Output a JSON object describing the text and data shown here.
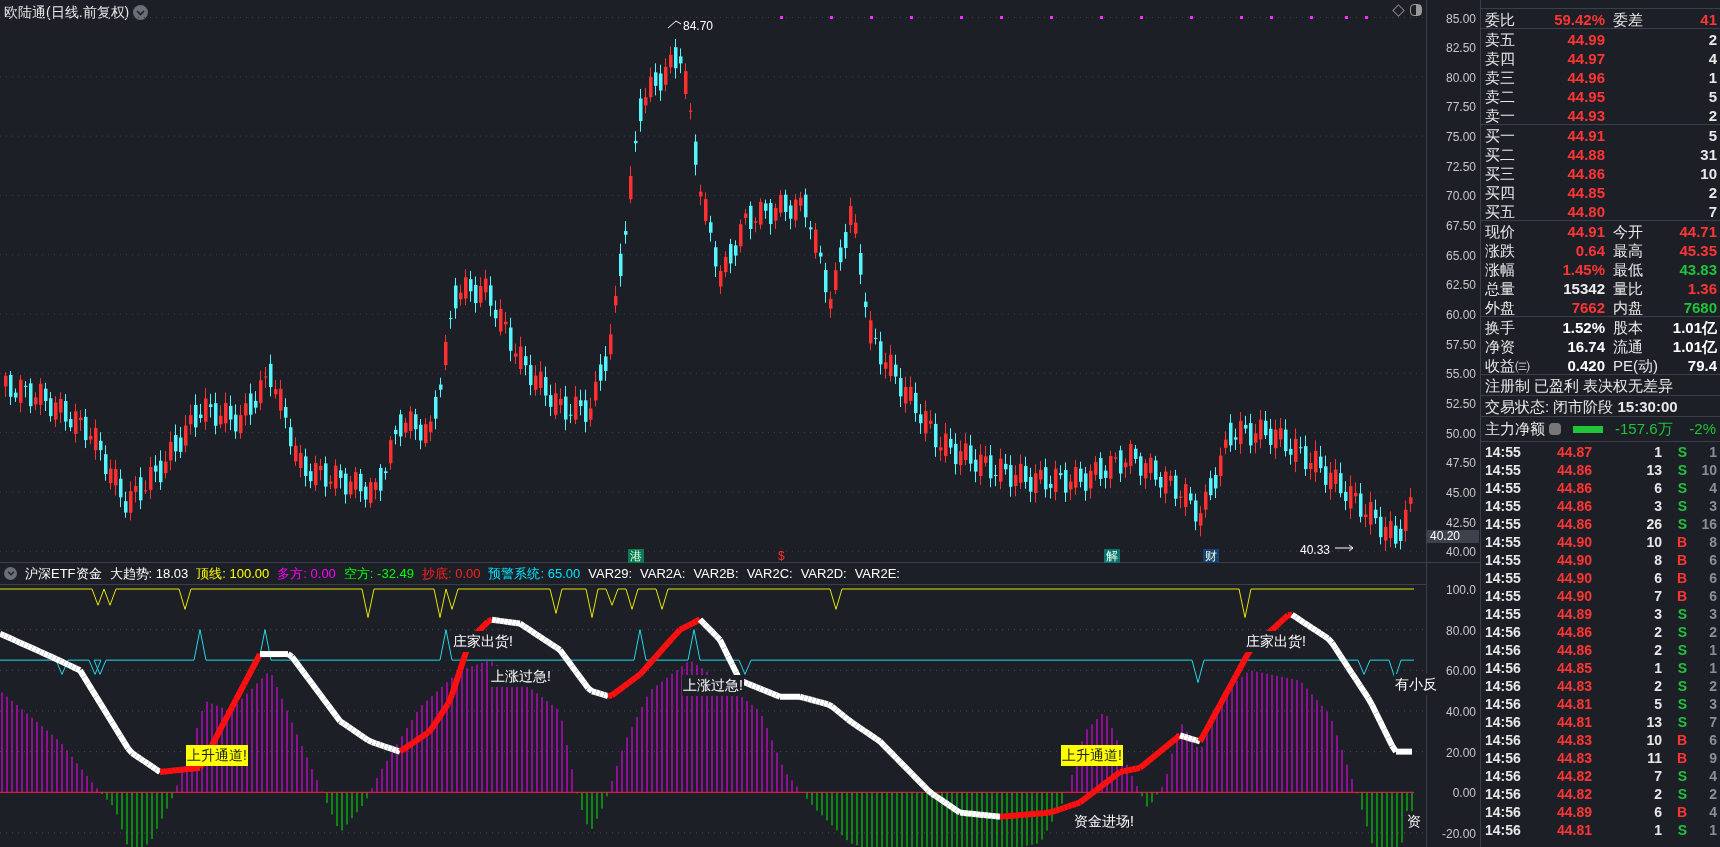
{
  "chart": {
    "title": "欧陆通(日线.前复权)",
    "high_label": "84.70",
    "low_label": "40.33",
    "current_price": "40.20",
    "price_ticks": [
      "85.00",
      "82.50",
      "80.00",
      "77.50",
      "75.00",
      "72.50",
      "70.00",
      "67.50",
      "65.00",
      "62.50",
      "60.00",
      "57.50",
      "55.00",
      "52.50",
      "50.00",
      "47.50",
      "45.00",
      "42.50",
      "40.00"
    ],
    "event_marks": [
      {
        "text": "港",
        "kind": "badge",
        "color": "#0b7a52"
      },
      {
        "text": "$",
        "kind": "plain",
        "color": "#ff2d2d"
      },
      {
        "text": "解",
        "kind": "badge",
        "color": "#0f7070"
      },
      {
        "text": "财",
        "kind": "badge",
        "color": "#1d3f6b"
      }
    ]
  },
  "indicator": {
    "legend": [
      {
        "text": "沪深ETF资金",
        "color": "#ffffff"
      },
      {
        "text": "大趋势: 18.03",
        "color": "#ffffff"
      },
      {
        "text": "顶线: 100.00",
        "color": "#ffff00"
      },
      {
        "text": "多方: 0.00",
        "color": "#ff00ff"
      },
      {
        "text": "空方: -32.49",
        "color": "#00ff00"
      },
      {
        "text": "抄底: 0.00",
        "color": "#ff2020"
      },
      {
        "text": "预警系统: 65.00",
        "color": "#00e5ff"
      },
      {
        "text": "VAR29:",
        "color": "#ffffff"
      },
      {
        "text": "VAR2A:",
        "color": "#ffffff"
      },
      {
        "text": "VAR2B:",
        "color": "#ffffff"
      },
      {
        "text": "VAR2C:",
        "color": "#ffffff"
      },
      {
        "text": "VAR2D:",
        "color": "#ffffff"
      },
      {
        "text": "VAR2E:",
        "color": "#ffffff"
      }
    ],
    "ticks": [
      "100.0",
      "80.00",
      "60.00",
      "40.00",
      "20.00",
      "0.00",
      "-20.00"
    ],
    "signals": [
      {
        "text": "庄家出货!",
        "kind": "plain"
      },
      {
        "text": "上涨过急!",
        "kind": "plain"
      },
      {
        "text": "上涨过急!",
        "kind": "plain"
      },
      {
        "text": "上升通道!",
        "kind": "highlight"
      },
      {
        "text": "上升通道!",
        "kind": "highlight"
      },
      {
        "text": "庄家出货!",
        "kind": "plain"
      },
      {
        "text": "资金进场!",
        "kind": "plain"
      },
      {
        "text": "有小反",
        "kind": "plain"
      },
      {
        "text": "资",
        "kind": "plain"
      }
    ]
  },
  "quote": {
    "ratio": {
      "label": "委比",
      "value": "59.42%",
      "label2": "委差",
      "value2": "41"
    },
    "asks": [
      {
        "label": "卖五",
        "price": "44.99",
        "volume": "2"
      },
      {
        "label": "卖四",
        "price": "44.97",
        "volume": "4"
      },
      {
        "label": "卖三",
        "price": "44.96",
        "volume": "1"
      },
      {
        "label": "卖二",
        "price": "44.95",
        "volume": "5"
      },
      {
        "label": "卖一",
        "price": "44.93",
        "volume": "2"
      }
    ],
    "bids": [
      {
        "label": "买一",
        "price": "44.91",
        "volume": "5"
      },
      {
        "label": "买二",
        "price": "44.88",
        "volume": "31"
      },
      {
        "label": "买三",
        "price": "44.86",
        "volume": "10"
      },
      {
        "label": "买四",
        "price": "44.85",
        "volume": "2"
      },
      {
        "label": "买五",
        "price": "44.80",
        "volume": "7"
      }
    ],
    "stats": [
      {
        "label": "现价",
        "value": "44.91",
        "color": "#ff3535"
      },
      {
        "label": "今开",
        "value": "44.71",
        "color": "#ff3535"
      },
      {
        "label": "涨跌",
        "value": "0.64",
        "color": "#ff3535"
      },
      {
        "label": "最高",
        "value": "45.35",
        "color": "#ff3535"
      },
      {
        "label": "涨幅",
        "value": "1.45%",
        "color": "#ff3535"
      },
      {
        "label": "最低",
        "value": "43.83",
        "color": "#1fc43a"
      },
      {
        "label": "总量",
        "value": "15342",
        "color": "#eeeeee"
      },
      {
        "label": "量比",
        "value": "1.36",
        "color": "#ff3535"
      },
      {
        "label": "外盘",
        "value": "7662",
        "color": "#ff3535"
      },
      {
        "label": "内盘",
        "value": "7680",
        "color": "#1fc43a"
      }
    ],
    "finance": [
      {
        "label": "换手",
        "value": "1.52%"
      },
      {
        "label": "股本",
        "value": "1.01亿"
      },
      {
        "label": "净资",
        "value": "16.74"
      },
      {
        "label": "流通",
        "value": "1.01亿"
      },
      {
        "label": "收益㈢",
        "value": "0.420"
      },
      {
        "label": "PE(动)",
        "value": "79.4"
      }
    ],
    "tags": "注册制 已盈利 表决权无差异",
    "status": "交易状态: 闭市阶段 **15:30:00**",
    "main_force": {
      "label": "主力净额",
      "value": "-157.6万",
      "percent": "-2%"
    },
    "trades": [
      {
        "time": "14:55",
        "price": "44.87",
        "volume": "1",
        "side": "S",
        "color": "#1fc43a",
        "count": "1"
      },
      {
        "time": "14:55",
        "price": "44.86",
        "volume": "13",
        "side": "S",
        "color": "#1fc43a",
        "count": "10"
      },
      {
        "time": "14:55",
        "price": "44.86",
        "volume": "6",
        "side": "S",
        "color": "#1fc43a",
        "count": "4"
      },
      {
        "time": "14:55",
        "price": "44.86",
        "volume": "3",
        "side": "S",
        "color": "#1fc43a",
        "count": "3"
      },
      {
        "time": "14:55",
        "price": "44.86",
        "volume": "26",
        "side": "S",
        "color": "#1fc43a",
        "count": "16"
      },
      {
        "time": "14:55",
        "price": "44.90",
        "volume": "10",
        "side": "B",
        "color": "#ff3535",
        "count": "8"
      },
      {
        "time": "14:55",
        "price": "44.90",
        "volume": "8",
        "side": "B",
        "color": "#ff3535",
        "count": "6"
      },
      {
        "time": "14:55",
        "price": "44.90",
        "volume": "6",
        "side": "B",
        "color": "#ff3535",
        "count": "6"
      },
      {
        "time": "14:55",
        "price": "44.90",
        "volume": "7",
        "side": "B",
        "color": "#ff3535",
        "count": "6"
      },
      {
        "time": "14:55",
        "price": "44.89",
        "volume": "3",
        "side": "S",
        "color": "#1fc43a",
        "count": "3"
      },
      {
        "time": "14:56",
        "price": "44.86",
        "volume": "2",
        "side": "S",
        "color": "#1fc43a",
        "count": "2"
      },
      {
        "time": "14:56",
        "price": "44.86",
        "volume": "2",
        "side": "S",
        "color": "#1fc43a",
        "count": "1"
      },
      {
        "time": "14:56",
        "price": "44.85",
        "volume": "1",
        "side": "S",
        "color": "#1fc43a",
        "count": "1"
      },
      {
        "time": "14:56",
        "price": "44.83",
        "volume": "2",
        "side": "S",
        "color": "#1fc43a",
        "count": "2"
      },
      {
        "time": "14:56",
        "price": "44.81",
        "volume": "5",
        "side": "S",
        "color": "#1fc43a",
        "count": "3"
      },
      {
        "time": "14:56",
        "price": "44.81",
        "volume": "13",
        "side": "S",
        "color": "#1fc43a",
        "count": "7"
      },
      {
        "time": "14:56",
        "price": "44.83",
        "volume": "10",
        "side": "B",
        "color": "#ff3535",
        "count": "6"
      },
      {
        "time": "14:56",
        "price": "44.83",
        "volume": "11",
        "side": "B",
        "color": "#ff3535",
        "count": "9"
      },
      {
        "time": "14:56",
        "price": "44.82",
        "volume": "7",
        "side": "S",
        "color": "#1fc43a",
        "count": "4"
      },
      {
        "time": "14:56",
        "price": "44.82",
        "volume": "2",
        "side": "S",
        "color": "#1fc43a",
        "count": "2"
      },
      {
        "time": "14:56",
        "price": "44.89",
        "volume": "6",
        "side": "B",
        "color": "#ff3535",
        "count": "4"
      },
      {
        "time": "14:56",
        "price": "44.81",
        "volume": "1",
        "side": "S",
        "color": "#1fc43a",
        "count": "1"
      }
    ]
  }
}
